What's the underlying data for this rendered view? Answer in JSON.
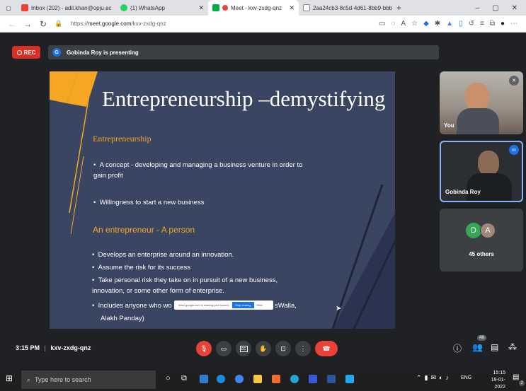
{
  "browser": {
    "tabs": [
      {
        "label": "Inbox (202) - adil.khan@opju.ac",
        "fav": "#ea4335",
        "active": false
      },
      {
        "label": "(1) WhatsApp",
        "fav": "#25d366",
        "active": false
      },
      {
        "label": "Meet - kxv-zxdg-qnz",
        "fav": "#00ac47",
        "active": true
      },
      {
        "label": "2aa24cb3-8c5d-4d61-8bb9-bbbc",
        "fav": "#888888",
        "active": false
      }
    ],
    "url_prefix": "https://",
    "url_host": "meet.google.com",
    "url_path": "/kxv-zxdg-qnz"
  },
  "meet": {
    "rec_label": "REC",
    "presenter_initial": "G",
    "presenting_text": "Gobinda Roy is presenting",
    "sharing_text": "meet.google.com is sharing your screen.",
    "stop_sharing": "Stop sharing",
    "hide": "Hide",
    "time": "3:15 PM",
    "separator": "|",
    "meeting_code": "kxv-zxdg-qnz",
    "participants_count": "48",
    "tiles": [
      {
        "name": "You"
      },
      {
        "name": "Gobinda Roy"
      }
    ],
    "others": {
      "avatars": [
        "D",
        "A"
      ],
      "label": "45 others"
    }
  },
  "slide": {
    "title": "Entrepreneurship –demystifying",
    "heading1": "Entrepreneurship",
    "bullets1": [
      "A concept - developing and managing a business venture in order to gain profit",
      "Willingness to start a new business"
    ],
    "heading2": "An entrepreneur  - A person",
    "bullets2": [
      "Develops an enterprise around an innovation.",
      "Assume the risk for its success",
      "Take personal risk they take on in pursuit of a new business, innovation, or some other form of enterprise.",
      "Includes anyone who wo",
      "sWalla,",
      "Alakh Panday)"
    ]
  },
  "taskbar": {
    "search_placeholder": "Type here to search",
    "lang": "ENG",
    "clock_time": "15:15",
    "clock_date": "19-01-2022",
    "notifications": "2"
  }
}
